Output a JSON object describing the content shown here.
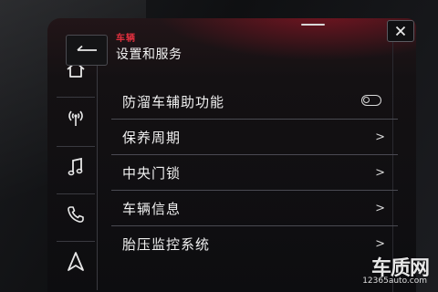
{
  "header": {
    "back_icon": "back-arrow-icon",
    "breadcrumb": "车辆",
    "title": "设置和服务",
    "close_icon": "close-icon"
  },
  "nav_rail": {
    "items": [
      {
        "icon": "home-icon"
      },
      {
        "icon": "radio-signal-icon"
      },
      {
        "icon": "music-note-icon"
      },
      {
        "icon": "phone-icon"
      },
      {
        "icon": "navigation-arrow-icon"
      }
    ]
  },
  "list": {
    "items": [
      {
        "label": "防溜车辅助功能",
        "control": "toggle",
        "toggle_on": false
      },
      {
        "label": "保养周期",
        "control": "chevron"
      },
      {
        "label": "中央门锁",
        "control": "chevron"
      },
      {
        "label": "车辆信息",
        "control": "chevron"
      },
      {
        "label": "胎压监控系统",
        "control": "chevron"
      }
    ],
    "chevron_glyph": ">"
  },
  "watermark": {
    "brand": "车质网",
    "url": "12365auto.com"
  },
  "colors": {
    "accent_red": "#e0303e",
    "text": "#f0f0f0",
    "divider": "#4a4a52",
    "background": "#0d0d10"
  }
}
